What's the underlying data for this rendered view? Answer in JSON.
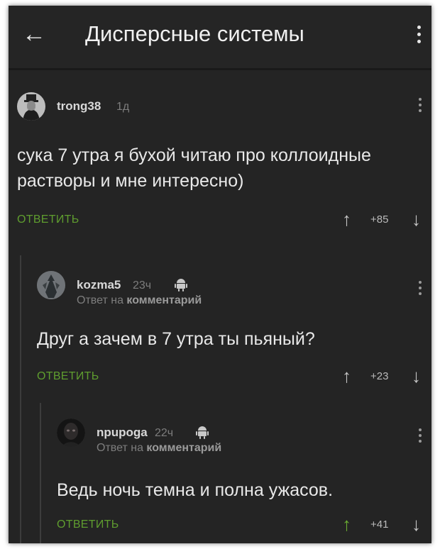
{
  "appbar": {
    "back_icon": "arrow-left-icon",
    "title": "Дисперсные системы",
    "menu_icon": "kebab-menu-icon"
  },
  "comments": [
    {
      "username": "trong38",
      "time": "1д",
      "reply_to_label": "",
      "reply_to_target": "",
      "body": "сука 7 утра я бухой читаю про коллоидные растворы  и мне интересно)",
      "reply_label": "ОТВЕТИТЬ",
      "score": "+85",
      "platform_icon": ""
    },
    {
      "username": "kozma5",
      "time": "23ч",
      "reply_to_label": "Ответ на",
      "reply_to_target": "комментарий",
      "body": "Друг а зачем в 7 утра ты пьяный?",
      "reply_label": "ОТВЕТИТЬ",
      "score": "+23",
      "platform_icon": "android-icon"
    },
    {
      "username": "npuроɡa",
      "time": "22ч",
      "reply_to_label": "Ответ на",
      "reply_to_target": "комментарий",
      "body": "Ведь ночь темна и полна ужасов.",
      "reply_label": "ОТВЕТИТЬ",
      "score": "+41",
      "platform_icon": "android-icon"
    }
  ],
  "colors": {
    "background": "#242424",
    "accent_green": "#5f9d2f",
    "text": "#e8e8e8",
    "muted": "#7d7d7d"
  }
}
